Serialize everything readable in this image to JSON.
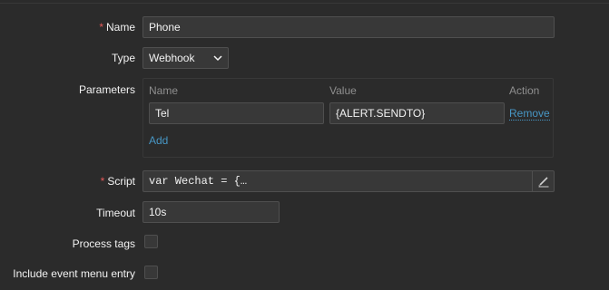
{
  "form": {
    "name": {
      "label": "Name",
      "required_mark": "*",
      "value": "Phone"
    },
    "type": {
      "label": "Type",
      "value": "Webhook"
    },
    "parameters": {
      "label": "Parameters",
      "columns": {
        "name": "Name",
        "value": "Value",
        "action": "Action"
      },
      "rows": [
        {
          "name": "Tel",
          "value": "{ALERT.SENDTO}",
          "action": "Remove"
        }
      ],
      "add_label": "Add"
    },
    "script": {
      "label": "Script",
      "required_mark": "*",
      "value": "var Wechat = {…"
    },
    "timeout": {
      "label": "Timeout",
      "value": "10s"
    },
    "process_tags": {
      "label": "Process tags",
      "checked": false
    },
    "include_event_menu_entry": {
      "label": "Include event menu entry",
      "checked": false
    }
  },
  "colors": {
    "background": "#2b2b2b",
    "input_bg": "#383838",
    "border": "#4f4f4f",
    "required": "#e45959",
    "link": "#4796c4",
    "muted": "#8f8f8f"
  }
}
